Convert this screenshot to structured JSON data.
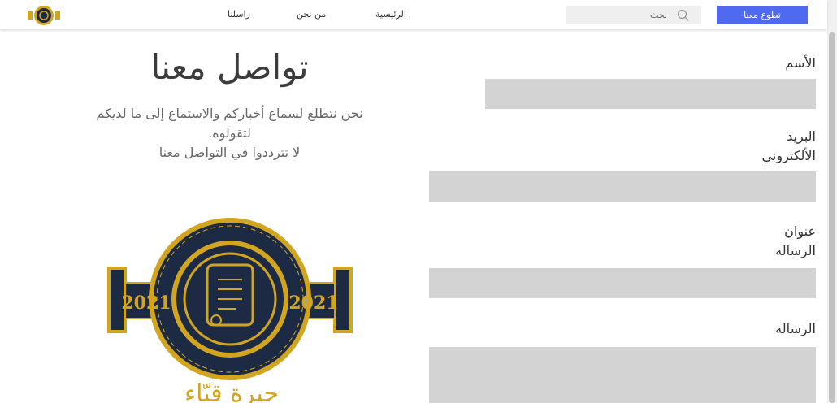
{
  "header": {
    "nav": {
      "home": "الرئيسية",
      "about": "من نحن",
      "contact": "راسلنا"
    },
    "search_placeholder": "بحث",
    "volunteer_label": "تطوع معنا"
  },
  "contact": {
    "title": "تواصل معنا",
    "intro_line1": "نحن نتطلع لسماع أخباركم والاستماع إلى ما لديكم",
    "intro_line2": "لتقولوه.",
    "intro_line3": "لا تترددوا في التواصل معنا"
  },
  "form": {
    "name_label": "الأسم",
    "email_label_line1": "البريد",
    "email_label_line2": "الألكتروني",
    "subject_label_line1": "عنوان",
    "subject_label_line2": "الرسالة",
    "message_label": "الرسالة"
  },
  "emblem": {
    "year_left": "2021",
    "year_right": "2021",
    "caption": "جيرة قيّاء"
  },
  "colors": {
    "accent_button": "#4f6af0",
    "field_bg": "#d3d3d3",
    "emblem_gold": "#d2a520",
    "emblem_navy": "#1d2a44"
  }
}
